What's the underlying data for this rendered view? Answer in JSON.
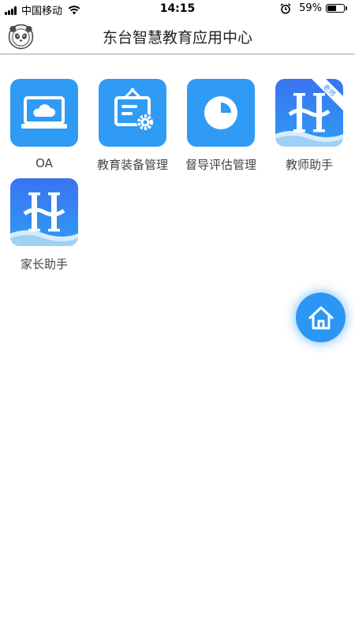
{
  "status_bar": {
    "carrier": "中国移动",
    "time": "14:15",
    "battery_percent": "59%",
    "battery_level": 0.59,
    "icons": [
      "signal-icon",
      "wifi-icon",
      "alarm-icon",
      "battery-icon"
    ]
  },
  "header": {
    "title": "东台智慧教育应用中心",
    "avatar_icon": "panda-avatar-icon"
  },
  "apps": [
    {
      "label": "OA",
      "icon": "laptop-cloud-icon"
    },
    {
      "label": "教育装备管理",
      "icon": "equipment-board-icon"
    },
    {
      "label": "督导评估管理",
      "icon": "pie-chart-icon"
    },
    {
      "label": "教师助手",
      "icon": "h-logo-icon",
      "badge": "老师"
    },
    {
      "label": "家长助手",
      "icon": "h-logo-icon"
    }
  ],
  "fab": {
    "icon": "home-icon"
  },
  "colors": {
    "accent": "#2f9bf5",
    "fab": "#2b96f3",
    "header_border": "#9aa7b4",
    "label_text": "#444444"
  }
}
